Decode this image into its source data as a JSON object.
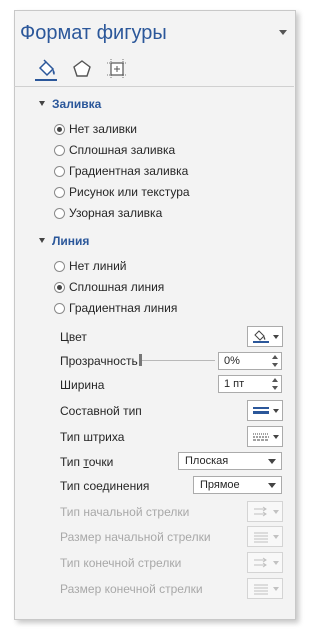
{
  "pane": {
    "title": "Формат фигуры",
    "tabs": [
      {
        "name": "fill-line-tab-icon"
      },
      {
        "name": "effects-tab-icon"
      },
      {
        "name": "size-properties-tab-icon"
      }
    ]
  },
  "fill": {
    "section_title": "Заливка",
    "options": [
      {
        "label": "Нет заливки",
        "checked": true
      },
      {
        "label": "Сплошная заливка",
        "checked": false
      },
      {
        "label": "Градиентная заливка",
        "checked": false
      },
      {
        "label": "Рисунок или текстура",
        "checked": false
      },
      {
        "label": "Узорная заливка",
        "checked": false
      }
    ]
  },
  "line": {
    "section_title": "Линия",
    "options": [
      {
        "label": "Нет линий",
        "checked": false
      },
      {
        "label": "Сплошная линия",
        "checked": true
      },
      {
        "label": "Градиентная линия",
        "checked": false
      }
    ],
    "color_label": "Цвет",
    "transparency_label": "Прозрачность",
    "transparency_value": "0%",
    "width_label": "Ширина",
    "width_value": "1 пт",
    "compound_label": "Составной тип",
    "dash_label": "Тип штриха",
    "cap_label": "Тип точки",
    "cap_value": "Плоская",
    "join_label": "Тип соединения",
    "join_value": "Прямое",
    "begin_arrow_type_label": "Тип начальной стрелки",
    "begin_arrow_size_label": "Размер начальной стрелки",
    "end_arrow_type_label": "Тип конечной стрелки",
    "end_arrow_size_label": "Размер конечной стрелки"
  },
  "colors": {
    "accent": "#2b579a",
    "pane_bg": "#f3f3f3",
    "text": "#262626",
    "disabled_text": "#a8a8a8"
  }
}
